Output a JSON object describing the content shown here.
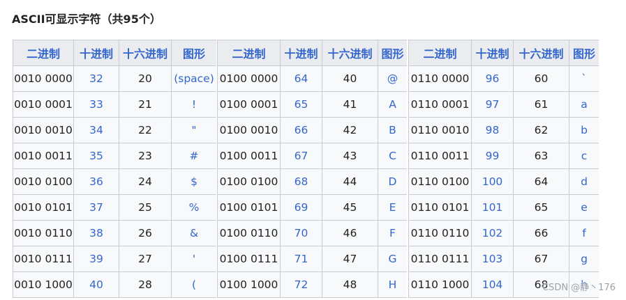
{
  "heading": "ASCII可显示字符（共95个）",
  "columns": [
    "二进制",
    "十进制",
    "十六进制",
    "图形"
  ],
  "groups": [
    {
      "rows": [
        {
          "bin": "0010 0000",
          "dec": "32",
          "hex": "20",
          "glyph": "(space)"
        },
        {
          "bin": "0010 0001",
          "dec": "33",
          "hex": "21",
          "glyph": "!"
        },
        {
          "bin": "0010 0010",
          "dec": "34",
          "hex": "22",
          "glyph": "\""
        },
        {
          "bin": "0010 0011",
          "dec": "35",
          "hex": "23",
          "glyph": "#"
        },
        {
          "bin": "0010 0100",
          "dec": "36",
          "hex": "24",
          "glyph": "$"
        },
        {
          "bin": "0010 0101",
          "dec": "37",
          "hex": "25",
          "glyph": "%"
        },
        {
          "bin": "0010 0110",
          "dec": "38",
          "hex": "26",
          "glyph": "&"
        },
        {
          "bin": "0010 0111",
          "dec": "39",
          "hex": "27",
          "glyph": "'"
        },
        {
          "bin": "0010 1000",
          "dec": "40",
          "hex": "28",
          "glyph": "("
        }
      ]
    },
    {
      "rows": [
        {
          "bin": "0100 0000",
          "dec": "64",
          "hex": "40",
          "glyph": "@"
        },
        {
          "bin": "0100 0001",
          "dec": "65",
          "hex": "41",
          "glyph": "A"
        },
        {
          "bin": "0100 0010",
          "dec": "66",
          "hex": "42",
          "glyph": "B"
        },
        {
          "bin": "0100 0011",
          "dec": "67",
          "hex": "43",
          "glyph": "C"
        },
        {
          "bin": "0100 0100",
          "dec": "68",
          "hex": "44",
          "glyph": "D"
        },
        {
          "bin": "0100 0101",
          "dec": "69",
          "hex": "45",
          "glyph": "E"
        },
        {
          "bin": "0100 0110",
          "dec": "70",
          "hex": "46",
          "glyph": "F"
        },
        {
          "bin": "0100 0111",
          "dec": "71",
          "hex": "47",
          "glyph": "G"
        },
        {
          "bin": "0100 1000",
          "dec": "72",
          "hex": "48",
          "glyph": "H"
        }
      ]
    },
    {
      "rows": [
        {
          "bin": "0110 0000",
          "dec": "96",
          "hex": "60",
          "glyph": "`"
        },
        {
          "bin": "0110 0001",
          "dec": "97",
          "hex": "61",
          "glyph": "a"
        },
        {
          "bin": "0110 0010",
          "dec": "98",
          "hex": "62",
          "glyph": "b"
        },
        {
          "bin": "0110 0011",
          "dec": "99",
          "hex": "63",
          "glyph": "c"
        },
        {
          "bin": "0110 0100",
          "dec": "100",
          "hex": "64",
          "glyph": "d"
        },
        {
          "bin": "0110 0101",
          "dec": "101",
          "hex": "65",
          "glyph": "e"
        },
        {
          "bin": "0110 0110",
          "dec": "102",
          "hex": "66",
          "glyph": "f"
        },
        {
          "bin": "0110 0111",
          "dec": "103",
          "hex": "67",
          "glyph": "g"
        },
        {
          "bin": "0110 1000",
          "dec": "104",
          "hex": "68",
          "glyph": "h"
        }
      ]
    }
  ],
  "watermark": "CSDN @静丶176"
}
